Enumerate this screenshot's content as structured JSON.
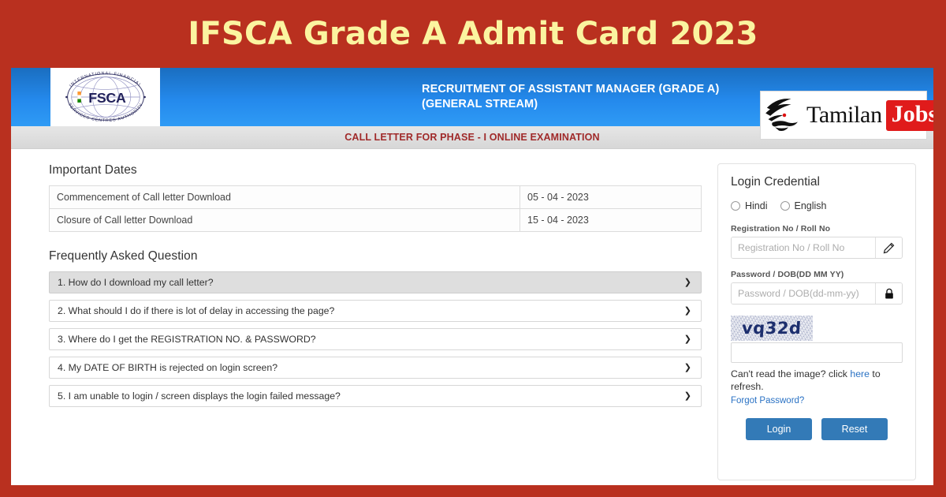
{
  "banner": {
    "title": "IFSCA Grade A Admit Card 2023",
    "bg_color": "#b9301f",
    "text_color": "#fbf4a0"
  },
  "site_header": {
    "logo_alt": "IFSCA",
    "logo_top_arc": "INTERNATIONAL  FINANCIAL",
    "logo_bottom_arc": "SERVICES  CENTRES  AUTHORITY",
    "logo_wordmark": "IFSCA",
    "recruitment_text": "RECRUITMENT OF ASSISTANT MANAGER (GRADE A) (GENERAL STREAM)",
    "watermark_brand_1": "Tamilan",
    "watermark_brand_2": "Jobs",
    "bg_color": "#2489ec"
  },
  "call_strip": {
    "text": "CALL LETTER FOR PHASE - I ONLINE EXAMINATION",
    "text_color": "#a02a2a"
  },
  "important_dates": {
    "heading": "Important Dates",
    "rows": [
      {
        "label": "Commencement of Call letter Download",
        "value": "05 - 04 - 2023"
      },
      {
        "label": "Closure of Call letter Download",
        "value": "15 - 04 - 2023"
      }
    ]
  },
  "faq": {
    "heading": "Frequently Asked Question",
    "chevron": "❯",
    "items": [
      {
        "text": "1. How do I download my call letter?",
        "active": true
      },
      {
        "text": "2. What should I do if there is lot of delay in accessing the page?",
        "active": false
      },
      {
        "text": "3. Where do I get the REGISTRATION NO. & PASSWORD?",
        "active": false
      },
      {
        "text": "4. My DATE OF BIRTH is rejected on login screen?",
        "active": false
      },
      {
        "text": "5. I am unable to login / screen displays the login failed message?",
        "active": false
      }
    ]
  },
  "login": {
    "title": "Login Credential",
    "language_options": [
      {
        "label": "Hindi",
        "selected": false
      },
      {
        "label": "English",
        "selected": false
      }
    ],
    "registration": {
      "label": "Registration No / Roll No",
      "placeholder": "Registration No / Roll No",
      "value": "",
      "addon_icon": "pencil-icon"
    },
    "password": {
      "label": "Password / DOB(DD MM YY)",
      "placeholder": "Password / DOB(dd-mm-yy)",
      "value": "",
      "addon_icon": "lock-icon"
    },
    "captcha": {
      "text": "vq32d",
      "input_value": "",
      "text_color": "#1d2f6e"
    },
    "refresh_text_before": "Can't read the image? click ",
    "refresh_link": "here",
    "refresh_text_after": " to refresh.",
    "forgot_password": "Forgot Password?",
    "buttons": {
      "login": "Login",
      "reset": "Reset",
      "color": "#337ab7"
    }
  }
}
